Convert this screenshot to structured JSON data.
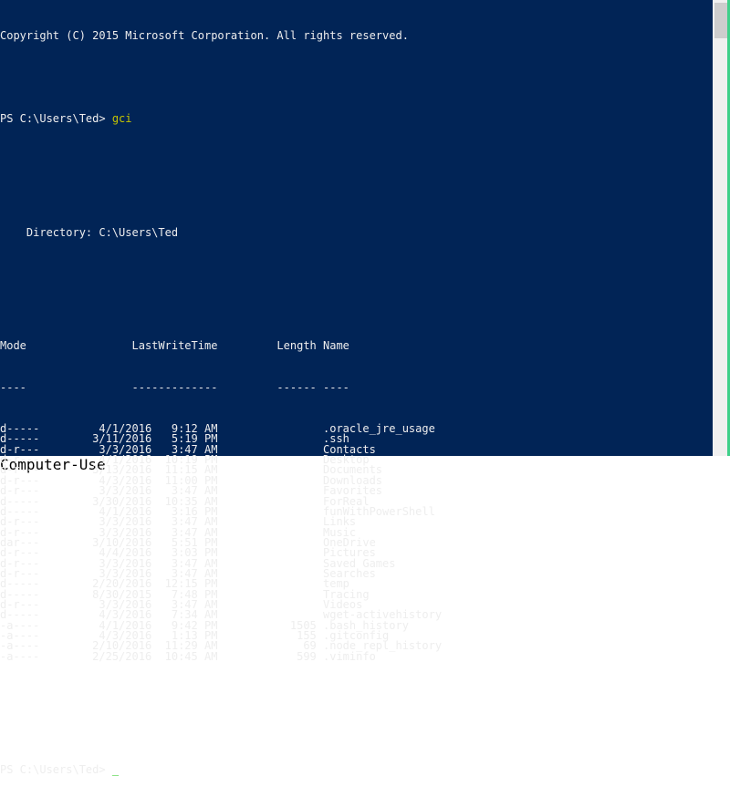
{
  "console": {
    "background_color": "#012456",
    "foreground_color": "#EEEEEE",
    "command_color": "#C5C500",
    "cursor_color": "#16C60C",
    "scrollbar_track_color": "#F0F0F0",
    "scrollbar_thumb_color": "#CDCDCD",
    "edge_accent_color": "#3FD08A"
  },
  "copyright": "Copyright (C) 2015 Microsoft Corporation. All rights reserved.",
  "prompt": {
    "text": "PS C:\\Users\\Ted> ",
    "command": "gci"
  },
  "directory_header": "    Directory: C:\\Users\\Ted",
  "table": {
    "headers": {
      "mode": "Mode",
      "lastwritetime": "LastWriteTime",
      "length": "Length",
      "name": "Name"
    },
    "header_line": "Mode                LastWriteTime         Length Name",
    "divider_line": "----                -------------         ------ ----",
    "rows": [
      {
        "mode": "d-----",
        "date": "4/1/2016",
        "time": "9:12 AM",
        "length": "",
        "name": ".oracle_jre_usage",
        "line": "d-----         4/1/2016   9:12 AM                .oracle_jre_usage"
      },
      {
        "mode": "d-----",
        "date": "3/11/2016",
        "time": "5:19 PM",
        "length": "",
        "name": ".ssh",
        "line": "d-----        3/11/2016   5:19 PM                .ssh"
      },
      {
        "mode": "d-r---",
        "date": "3/3/2016",
        "time": "3:47 AM",
        "length": "",
        "name": "Contacts",
        "line": "d-r---         3/3/2016   3:47 AM                Contacts"
      },
      {
        "mode": "d-r---",
        "date": "4/1/2016",
        "time": "10:19 PM",
        "length": "",
        "name": "Desktop",
        "line": "d-r---         4/1/2016  10:19 PM                Desktop"
      },
      {
        "mode": "d-r---",
        "date": "3/13/2016",
        "time": "11:15 AM",
        "length": "",
        "name": "Documents",
        "line": "d-r---        3/13/2016  11:15 AM                Documents"
      },
      {
        "mode": "d-r---",
        "date": "4/3/2016",
        "time": "11:00 PM",
        "length": "",
        "name": "Downloads",
        "line": "d-r---         4/3/2016  11:00 PM                Downloads"
      },
      {
        "mode": "d-r---",
        "date": "3/3/2016",
        "time": "3:47 AM",
        "length": "",
        "name": "Favorites",
        "line": "d-r---         3/3/2016   3:47 AM                Favorites"
      },
      {
        "mode": "d-----",
        "date": "3/30/2016",
        "time": "10:35 AM",
        "length": "",
        "name": "ForReal",
        "line": "d-----        3/30/2016  10:35 AM                ForReal"
      },
      {
        "mode": "d-----",
        "date": "4/1/2016",
        "time": "3:16 PM",
        "length": "",
        "name": "funWithPowerShell",
        "line": "d-----         4/1/2016   3:16 PM                funWithPowerShell"
      },
      {
        "mode": "d-r---",
        "date": "3/3/2016",
        "time": "3:47 AM",
        "length": "",
        "name": "Links",
        "line": "d-r---         3/3/2016   3:47 AM                Links"
      },
      {
        "mode": "d-r---",
        "date": "3/3/2016",
        "time": "3:47 AM",
        "length": "",
        "name": "Music",
        "line": "d-r---         3/3/2016   3:47 AM                Music"
      },
      {
        "mode": "dar---",
        "date": "3/10/2016",
        "time": "5:51 PM",
        "length": "",
        "name": "OneDrive",
        "line": "dar---        3/10/2016   5:51 PM                OneDrive"
      },
      {
        "mode": "d-r---",
        "date": "4/4/2016",
        "time": "3:03 PM",
        "length": "",
        "name": "Pictures",
        "line": "d-r---         4/4/2016   3:03 PM                Pictures"
      },
      {
        "mode": "d-r---",
        "date": "3/3/2016",
        "time": "3:47 AM",
        "length": "",
        "name": "Saved Games",
        "line": "d-r---         3/3/2016   3:47 AM                Saved Games"
      },
      {
        "mode": "d-r---",
        "date": "3/3/2016",
        "time": "3:47 AM",
        "length": "",
        "name": "Searches",
        "line": "d-r---         3/3/2016   3:47 AM                Searches"
      },
      {
        "mode": "d-----",
        "date": "2/20/2016",
        "time": "12:15 PM",
        "length": "",
        "name": "temp",
        "line": "d-----        2/20/2016  12:15 PM                temp"
      },
      {
        "mode": "d-----",
        "date": "8/30/2015",
        "time": "7:48 PM",
        "length": "",
        "name": "Tracing",
        "line": "d-----        8/30/2015   7:48 PM                Tracing"
      },
      {
        "mode": "d-r---",
        "date": "3/3/2016",
        "time": "3:47 AM",
        "length": "",
        "name": "Videos",
        "line": "d-r---         3/3/2016   3:47 AM                Videos"
      },
      {
        "mode": "d-----",
        "date": "4/3/2016",
        "time": "7:34 AM",
        "length": "",
        "name": "wget-activehistory",
        "line": "d-----         4/3/2016   7:34 AM                wget-activehistory"
      },
      {
        "mode": "-a----",
        "date": "4/1/2016",
        "time": "9:42 PM",
        "length": "1505",
        "name": ".bash_history",
        "line": "-a----         4/1/2016   9:42 PM           1505 .bash_history"
      },
      {
        "mode": "-a----",
        "date": "4/3/2016",
        "time": "1:13 PM",
        "length": "155",
        "name": ".gitconfig",
        "line": "-a----         4/3/2016   1:13 PM            155 .gitconfig"
      },
      {
        "mode": "-a----",
        "date": "2/10/2016",
        "time": "11:29 AM",
        "length": "69",
        "name": ".node_repl_history",
        "line": "-a----        2/10/2016  11:29 AM             69 .node_repl_history"
      },
      {
        "mode": "-a----",
        "date": "2/25/2016",
        "time": "10:45 AM",
        "length": "599",
        "name": ".viminfo",
        "line": "-a----        2/25/2016  10:45 AM            599 .viminfo"
      }
    ]
  },
  "final_prompt": {
    "text": "PS C:\\Users\\Ted> ",
    "cursor": "_"
  }
}
